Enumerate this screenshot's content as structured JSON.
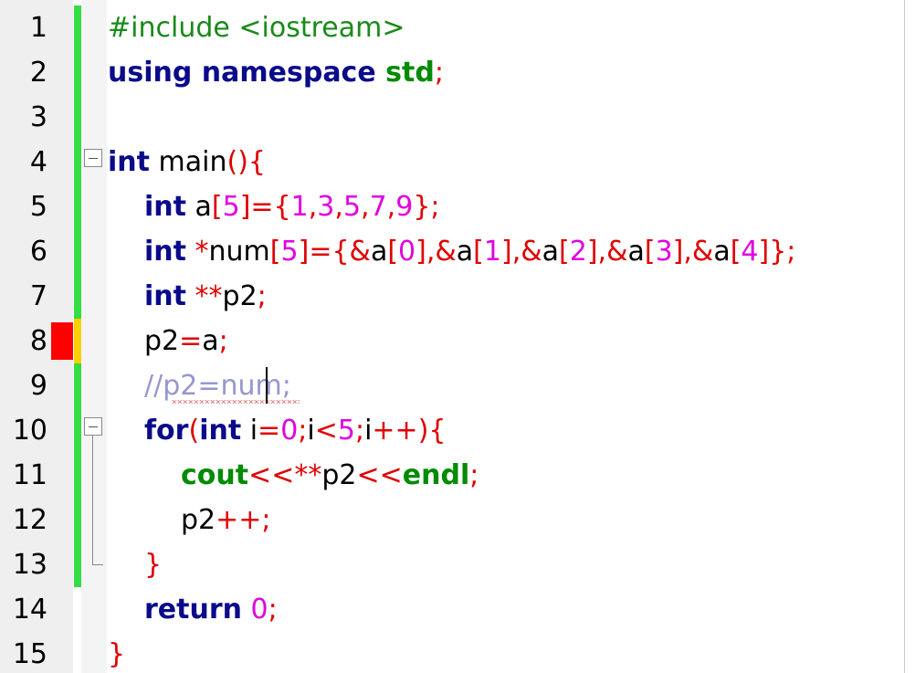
{
  "editor": {
    "colors": {
      "keyword": "#0a0a8a",
      "std": "#008b00",
      "symbol": "#e00000",
      "number": "#e000e0",
      "comment": "#9696d0",
      "identifier": "#000000",
      "preprocessor": "#1a8a1a",
      "changebar_saved": "#33dd44",
      "changebar_modified": "#ffd000",
      "breakpoint": "#ff0000"
    },
    "lines": [
      {
        "number": "1",
        "indent": 0,
        "changed": "saved",
        "tokens": [
          {
            "t": "#include <iostream>",
            "c": "preprocessor"
          }
        ]
      },
      {
        "number": "2",
        "indent": 0,
        "changed": "saved",
        "tokens": [
          {
            "t": "using namespace ",
            "c": "keyword",
            "b": true
          },
          {
            "t": "std",
            "c": "std",
            "b": true
          },
          {
            "t": ";",
            "c": "symbol"
          }
        ]
      },
      {
        "number": "3",
        "indent": 0,
        "changed": "saved",
        "tokens": []
      },
      {
        "number": "4",
        "indent": 0,
        "changed": "saved",
        "fold": "open",
        "tokens": [
          {
            "t": "int",
            "c": "keyword",
            "b": true
          },
          {
            "t": " main",
            "c": "identifier"
          },
          {
            "t": "(){",
            "c": "symbol"
          }
        ]
      },
      {
        "number": "5",
        "indent": 1,
        "changed": "saved",
        "tokens": [
          {
            "t": "int",
            "c": "keyword",
            "b": true
          },
          {
            "t": " a",
            "c": "identifier"
          },
          {
            "t": "[",
            "c": "symbol"
          },
          {
            "t": "5",
            "c": "number"
          },
          {
            "t": "]={",
            "c": "symbol"
          },
          {
            "t": "1",
            "c": "number"
          },
          {
            "t": ",",
            "c": "symbol"
          },
          {
            "t": "3",
            "c": "number"
          },
          {
            "t": ",",
            "c": "symbol"
          },
          {
            "t": "5",
            "c": "number"
          },
          {
            "t": ",",
            "c": "symbol"
          },
          {
            "t": "7",
            "c": "number"
          },
          {
            "t": ",",
            "c": "symbol"
          },
          {
            "t": "9",
            "c": "number"
          },
          {
            "t": "};",
            "c": "symbol"
          }
        ]
      },
      {
        "number": "6",
        "indent": 1,
        "changed": "saved",
        "tokens": [
          {
            "t": "int",
            "c": "keyword",
            "b": true
          },
          {
            "t": " *",
            "c": "symbol"
          },
          {
            "t": "num",
            "c": "identifier"
          },
          {
            "t": "[",
            "c": "symbol"
          },
          {
            "t": "5",
            "c": "number"
          },
          {
            "t": "]={&",
            "c": "symbol"
          },
          {
            "t": "a",
            "c": "identifier"
          },
          {
            "t": "[",
            "c": "symbol"
          },
          {
            "t": "0",
            "c": "number"
          },
          {
            "t": "],&",
            "c": "symbol"
          },
          {
            "t": "a",
            "c": "identifier"
          },
          {
            "t": "[",
            "c": "symbol"
          },
          {
            "t": "1",
            "c": "number"
          },
          {
            "t": "],&",
            "c": "symbol"
          },
          {
            "t": "a",
            "c": "identifier"
          },
          {
            "t": "[",
            "c": "symbol"
          },
          {
            "t": "2",
            "c": "number"
          },
          {
            "t": "],&",
            "c": "symbol"
          },
          {
            "t": "a",
            "c": "identifier"
          },
          {
            "t": "[",
            "c": "symbol"
          },
          {
            "t": "3",
            "c": "number"
          },
          {
            "t": "],&",
            "c": "symbol"
          },
          {
            "t": "a",
            "c": "identifier"
          },
          {
            "t": "[",
            "c": "symbol"
          },
          {
            "t": "4",
            "c": "number"
          },
          {
            "t": "]};",
            "c": "symbol"
          }
        ]
      },
      {
        "number": "7",
        "indent": 1,
        "changed": "saved",
        "tokens": [
          {
            "t": "int",
            "c": "keyword",
            "b": true
          },
          {
            "t": " **",
            "c": "symbol"
          },
          {
            "t": "p2",
            "c": "identifier"
          },
          {
            "t": ";",
            "c": "symbol"
          }
        ]
      },
      {
        "number": "8",
        "indent": 1,
        "changed": "modified",
        "breakpoint": true,
        "tokens": [
          {
            "t": "p2",
            "c": "identifier"
          },
          {
            "t": "=",
            "c": "symbol"
          },
          {
            "t": "a",
            "c": "identifier"
          },
          {
            "t": ";",
            "c": "symbol"
          }
        ]
      },
      {
        "number": "9",
        "indent": 1,
        "changed": "saved",
        "caret": true,
        "tokens": [
          {
            "t": "//p2=num;",
            "c": "comment"
          }
        ]
      },
      {
        "number": "10",
        "indent": 1,
        "changed": "saved",
        "fold": "open",
        "tokens": [
          {
            "t": "for",
            "c": "keyword",
            "b": true
          },
          {
            "t": "(",
            "c": "symbol"
          },
          {
            "t": "int",
            "c": "keyword",
            "b": true
          },
          {
            "t": " i",
            "c": "identifier"
          },
          {
            "t": "=",
            "c": "symbol"
          },
          {
            "t": "0",
            "c": "number"
          },
          {
            "t": ";",
            "c": "symbol"
          },
          {
            "t": "i",
            "c": "identifier"
          },
          {
            "t": "<",
            "c": "symbol"
          },
          {
            "t": "5",
            "c": "number"
          },
          {
            "t": ";",
            "c": "symbol"
          },
          {
            "t": "i",
            "c": "identifier"
          },
          {
            "t": "++){",
            "c": "symbol"
          }
        ]
      },
      {
        "number": "11",
        "indent": 2,
        "changed": "saved",
        "tokens": [
          {
            "t": "cout",
            "c": "std",
            "b": true
          },
          {
            "t": "<<**",
            "c": "symbol"
          },
          {
            "t": "p2",
            "c": "identifier"
          },
          {
            "t": "<<",
            "c": "symbol"
          },
          {
            "t": "endl",
            "c": "std",
            "b": true
          },
          {
            "t": ";",
            "c": "symbol"
          }
        ]
      },
      {
        "number": "12",
        "indent": 2,
        "changed": "saved",
        "tokens": [
          {
            "t": "p2",
            "c": "identifier"
          },
          {
            "t": "++;",
            "c": "symbol"
          }
        ]
      },
      {
        "number": "13",
        "indent": 1,
        "changed": "saved",
        "fold": "end",
        "tokens": [
          {
            "t": "}",
            "c": "symbol"
          }
        ]
      },
      {
        "number": "14",
        "indent": 1,
        "changed": "none",
        "tokens": [
          {
            "t": "return",
            "c": "keyword",
            "b": true
          },
          {
            "t": " ",
            "c": "identifier"
          },
          {
            "t": "0",
            "c": "number"
          },
          {
            "t": ";",
            "c": "symbol"
          }
        ]
      },
      {
        "number": "15",
        "indent": 0,
        "changed": "none",
        "tokens": [
          {
            "t": "}",
            "c": "symbol"
          }
        ]
      }
    ]
  }
}
